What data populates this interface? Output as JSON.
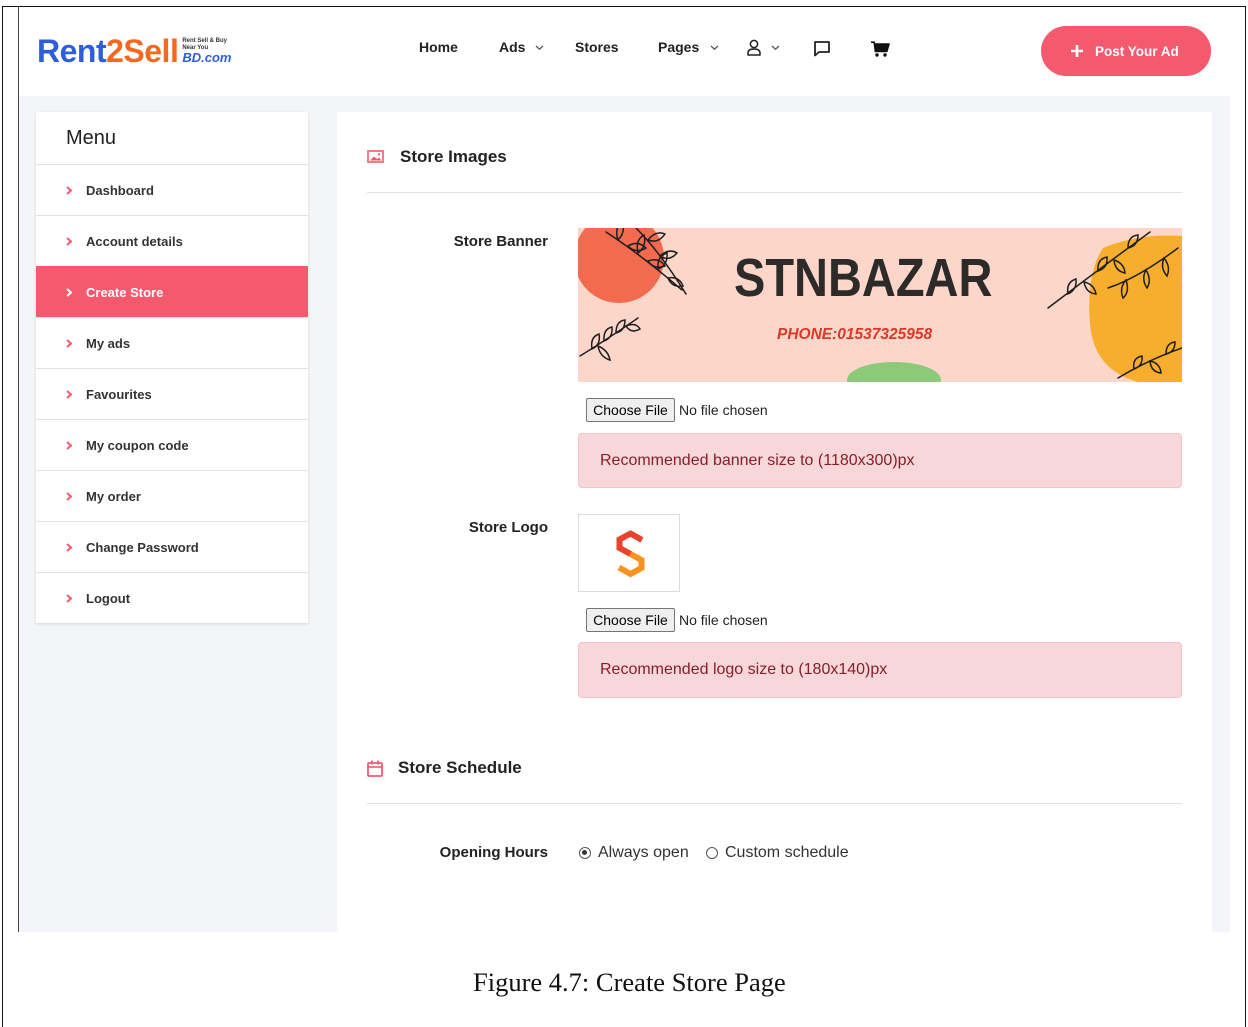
{
  "header": {
    "logo": {
      "part1": "Rent",
      "part2": "2Sell",
      "tag_line1": "Rent Sell & Buy",
      "tag_line2": "Near You",
      "tag_domain": "BD.com"
    },
    "nav": [
      {
        "label": "Home",
        "has_dropdown": false
      },
      {
        "label": "Ads",
        "has_dropdown": true
      },
      {
        "label": "Stores",
        "has_dropdown": false
      },
      {
        "label": "Pages",
        "has_dropdown": true
      }
    ],
    "icons": [
      "user-icon",
      "chat-icon",
      "cart-icon"
    ],
    "post_ad_label": "Post Your Ad"
  },
  "sidebar": {
    "title": "Menu",
    "active_index": 2,
    "items": [
      {
        "label": "Dashboard"
      },
      {
        "label": "Account details"
      },
      {
        "label": "Create Store"
      },
      {
        "label": "My ads"
      },
      {
        "label": "Favourites"
      },
      {
        "label": "My coupon code"
      },
      {
        "label": "My order"
      },
      {
        "label": "Change Password"
      },
      {
        "label": "Logout"
      }
    ]
  },
  "store_images": {
    "heading": "Store Images",
    "banner": {
      "label": "Store Banner",
      "image_title": "STNBAZAR",
      "image_phone": "PHONE:01537325958",
      "file_button": "Choose File",
      "file_status": "No file chosen",
      "hint": "Recommended banner size to (1180x300)px"
    },
    "logo": {
      "label": "Store Logo",
      "file_button": "Choose File",
      "file_status": "No file chosen",
      "hint": "Recommended logo size to (180x140)px"
    }
  },
  "store_schedule": {
    "heading": "Store Schedule",
    "opening_hours": {
      "label": "Opening Hours",
      "options": [
        {
          "label": "Always open",
          "checked": true
        },
        {
          "label": "Custom schedule",
          "checked": false
        }
      ]
    }
  },
  "caption": "Figure 4.7: Create Store Page",
  "colors": {
    "accent": "#f5596e",
    "alert_bg": "#f8d7da",
    "alert_text": "#842029",
    "page_bg": "#f4f5f8",
    "logo_blue": "#2e5fd8",
    "logo_orange": "#f26a21"
  }
}
